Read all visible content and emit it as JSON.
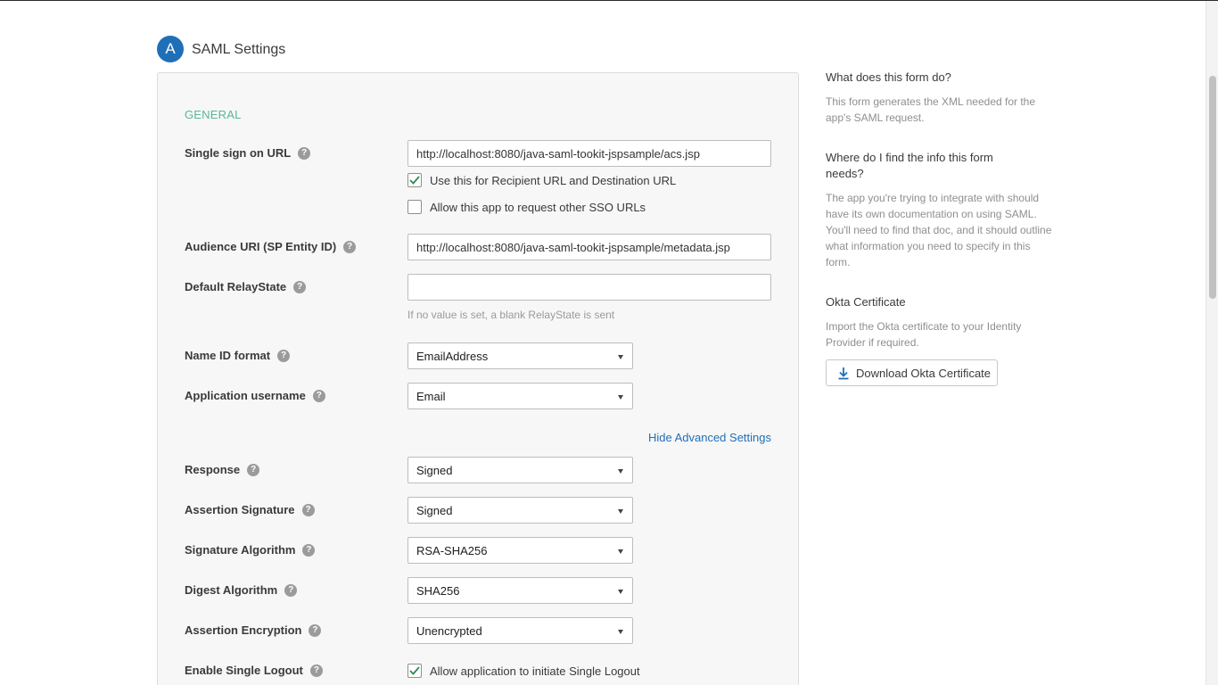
{
  "header": {
    "step": "A",
    "title": "SAML Settings"
  },
  "form": {
    "section_title": "GENERAL",
    "help_glyph": "?",
    "sso_url": {
      "label": "Single sign on URL",
      "value": "http://localhost:8080/java-saml-tookit-jspsample/acs.jsp"
    },
    "use_recipient": {
      "label": "Use this for Recipient URL and Destination URL",
      "checked": true
    },
    "allow_other_sso": {
      "label": "Allow this app to request other SSO URLs",
      "checked": false
    },
    "audience_uri": {
      "label": "Audience URI (SP Entity ID)",
      "value": "http://localhost:8080/java-saml-tookit-jspsample/metadata.jsp"
    },
    "relay_state": {
      "label": "Default RelayState",
      "value": "",
      "hint": "If no value is set, a blank RelayState is sent"
    },
    "name_id_format": {
      "label": "Name ID format",
      "value": "EmailAddress"
    },
    "app_username": {
      "label": "Application username",
      "value": "Email"
    },
    "advanced_link": "Hide Advanced Settings",
    "response": {
      "label": "Response",
      "value": "Signed"
    },
    "assertion_signature": {
      "label": "Assertion Signature",
      "value": "Signed"
    },
    "signature_algorithm": {
      "label": "Signature Algorithm",
      "value": "RSA-SHA256"
    },
    "digest_algorithm": {
      "label": "Digest Algorithm",
      "value": "SHA256"
    },
    "assertion_encryption": {
      "label": "Assertion Encryption",
      "value": "Unencrypted"
    },
    "single_logout": {
      "label": "Enable Single Logout",
      "option_label": "Allow application to initiate Single Logout",
      "checked": true
    }
  },
  "sidebar": {
    "q1": "What does this form do?",
    "a1": "This form generates the XML needed for the app's SAML request.",
    "q2": "Where do I find the info this form needs?",
    "a2": "The app you're trying to integrate with should have its own documentation on using SAML. You'll need to find that doc, and it should outline what information you need to specify in this form.",
    "cert_heading": "Okta Certificate",
    "cert_text": "Import the Okta certificate to your Identity Provider if required.",
    "download_label": "Download Okta Certificate"
  },
  "icons": {
    "checkmark": "check-icon",
    "help": "help-icon",
    "download": "download-icon",
    "caret": "chevron-down-icon"
  },
  "colors": {
    "accent": "#1f6fb8",
    "section": "#59b69a",
    "check": "#2e8b57"
  }
}
